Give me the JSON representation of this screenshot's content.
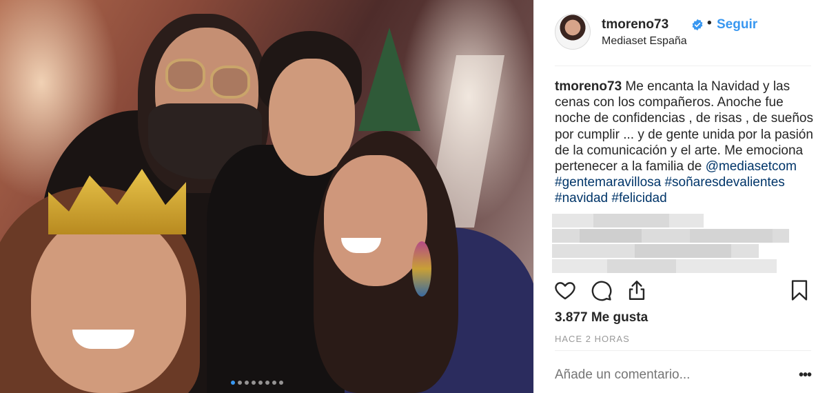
{
  "post": {
    "photo": {
      "carousel_count": 8,
      "active_index": 0
    },
    "header": {
      "username": "tmoreno73",
      "separator": "•",
      "follow_label": "Seguir",
      "location": "Mediaset España"
    },
    "caption": {
      "username": "tmoreno73",
      "text": "Me encanta la Navidad y las cenas con los compañeros. Anoche fue noche de confidencias , de risas , de sueños por cumplir ... y de gente unida por la pasión de la comunicación y el arte. Me emociona pertenecer a la familia de ",
      "mention": "@mediasetcom",
      "hashtags": [
        "#gentemaravillosa",
        "#soñaresdevalientes",
        "#navidad",
        "#felicidad"
      ]
    },
    "likes_label": "3.877 Me gusta",
    "time_label": "HACE 2 HORAS",
    "comment_placeholder": "Añade un comentario...",
    "more_label": "•••",
    "icons": [
      "heart-icon",
      "comment-icon",
      "share-icon",
      "bookmark-icon",
      "verified-badge-icon"
    ],
    "colors": {
      "link": "#3897f0",
      "hashtag": "#003569",
      "text": "#262626",
      "muted": "#999999"
    }
  }
}
